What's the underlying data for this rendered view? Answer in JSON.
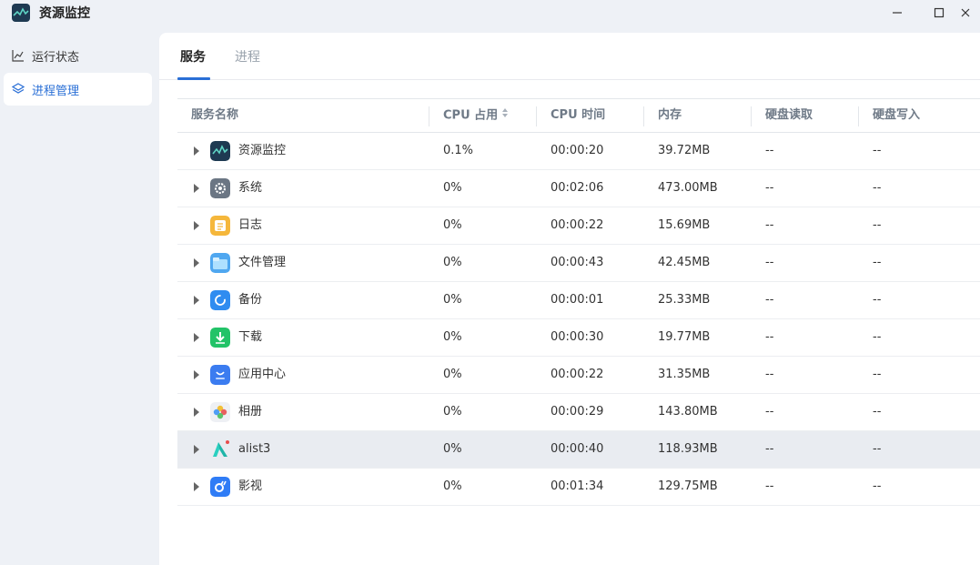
{
  "window": {
    "title": "资源监控",
    "minimize": "—",
    "maximize": "☐",
    "close": "✕"
  },
  "sidebar": {
    "items": [
      {
        "label": "运行状态",
        "icon": "line-chart-icon"
      },
      {
        "label": "进程管理",
        "icon": "layers-icon"
      }
    ]
  },
  "tabs": [
    {
      "label": "服务"
    },
    {
      "label": "进程"
    }
  ],
  "table": {
    "columns": [
      "服务名称",
      "CPU 占用",
      "CPU 时间",
      "内存",
      "硬盘读取",
      "硬盘写入"
    ],
    "rows": [
      {
        "name": "资源监控",
        "icon": "resource-monitor-icon",
        "cpu": "0.1%",
        "time": "00:00:20",
        "mem": "39.72MB",
        "read": "--",
        "write": "--"
      },
      {
        "name": "系统",
        "icon": "system-gear-icon",
        "cpu": "0%",
        "time": "00:02:06",
        "mem": "473.00MB",
        "read": "--",
        "write": "--"
      },
      {
        "name": "日志",
        "icon": "log-icon",
        "cpu": "0%",
        "time": "00:00:22",
        "mem": "15.69MB",
        "read": "--",
        "write": "--"
      },
      {
        "name": "文件管理",
        "icon": "folder-icon",
        "cpu": "0%",
        "time": "00:00:43",
        "mem": "42.45MB",
        "read": "--",
        "write": "--"
      },
      {
        "name": "备份",
        "icon": "backup-icon",
        "cpu": "0%",
        "time": "00:00:01",
        "mem": "25.33MB",
        "read": "--",
        "write": "--"
      },
      {
        "name": "下载",
        "icon": "download-icon",
        "cpu": "0%",
        "time": "00:00:30",
        "mem": "19.77MB",
        "read": "--",
        "write": "--"
      },
      {
        "name": "应用中心",
        "icon": "app-store-icon",
        "cpu": "0%",
        "time": "00:00:22",
        "mem": "31.35MB",
        "read": "--",
        "write": "--"
      },
      {
        "name": "相册",
        "icon": "photos-icon",
        "cpu": "0%",
        "time": "00:00:29",
        "mem": "143.80MB",
        "read": "--",
        "write": "--"
      },
      {
        "name": "alist3",
        "icon": "alist-icon",
        "cpu": "0%",
        "time": "00:00:40",
        "mem": "118.93MB",
        "read": "--",
        "write": "--"
      },
      {
        "name": "影视",
        "icon": "video-icon",
        "cpu": "0%",
        "time": "00:01:34",
        "mem": "129.75MB",
        "read": "--",
        "write": "--"
      }
    ]
  },
  "colors": {
    "accent": "#2a6fd6",
    "background": "#eef1f6",
    "highlight_row": "#e9ecf1"
  }
}
